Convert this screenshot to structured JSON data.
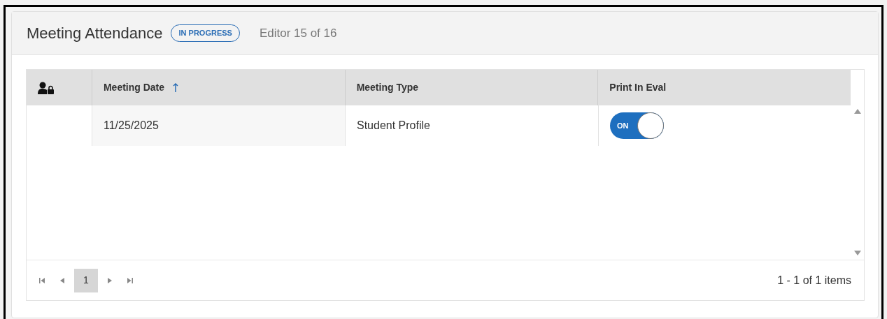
{
  "header": {
    "title": "Meeting Attendance",
    "status_badge": "IN PROGRESS",
    "editor_position": "Editor 15 of 16"
  },
  "table": {
    "columns": [
      {
        "kind": "icon"
      },
      {
        "kind": "text",
        "label": "Meeting Date",
        "sorted": true
      },
      {
        "kind": "text",
        "label": "Meeting Type",
        "sorted": false
      },
      {
        "kind": "text",
        "label": "Print In Eval",
        "sorted": false
      }
    ],
    "rows": [
      {
        "meeting_date": "11/25/2025",
        "meeting_type": "Student Profile",
        "print_in_eval": {
          "on": true,
          "label": "ON"
        }
      }
    ]
  },
  "pager": {
    "pages": [
      {
        "label": "1",
        "selected": true
      }
    ],
    "summary": "1 - 1 of 1 items"
  }
}
